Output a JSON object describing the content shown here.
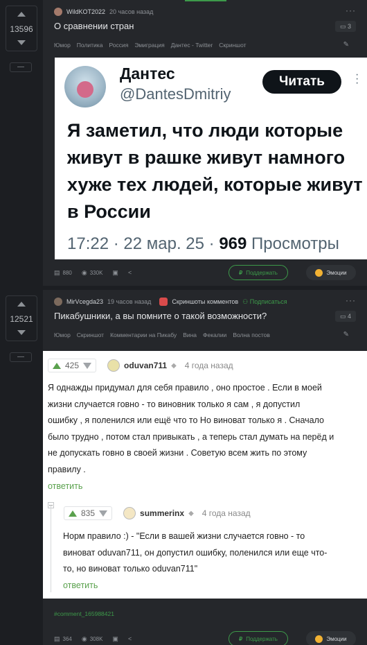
{
  "post1": {
    "votes": "13596",
    "minus": "—",
    "author": "WildKOT2022",
    "time": "20 часов назад",
    "title": "О сравнении стран",
    "comment_count": "3",
    "tags": [
      "Юмор",
      "Политика",
      "Россия",
      "Эмиграция",
      "Дантес - Twitter",
      "Скриншот"
    ],
    "tweet": {
      "name": "Дантес",
      "handle": "@DantesDmitriy",
      "follow_label": "Читать",
      "text": "Я заметил, что люди которые живут в рашке живут намного хуже  тех людей, которые живут в России",
      "footer_time": "17:22 · 22 мар. 25 · ",
      "views_num": "969",
      "views_label": " Просмотры"
    },
    "actions": {
      "comments": "880",
      "views": "330K",
      "support_label": "Поддержать",
      "emotions_label": "Эмоции"
    }
  },
  "post2": {
    "votes": "12521",
    "minus": "—",
    "author": "MirVcegda23",
    "time": "19 часов назад",
    "community": "Скриншоты комментов",
    "subscribe": "Подписаться",
    "title": "Пикабушники, а вы помните о такой возможности?",
    "comment_count": "4",
    "tags": [
      "Юмор",
      "Скриншот",
      "Комментарии на Пикабу",
      "Вина",
      "Фекалии",
      "Волна постов"
    ],
    "comment1": {
      "rating": "425",
      "user": "oduvan711",
      "time": "4 года назад",
      "lines": [
        "Я однажды придумал для себя правило , оно простое . Если в моей",
        "жизни случается говно - то виновник только я сам , я допустил",
        "ошибку , я поленился или ещё что то Но виноват только я . Сначало",
        "было трудно , потом стал привыкать , а теперь стал думать на перёд и",
        "не допускать говно в своей жизни . Советую всем жить по этому",
        "правилу ."
      ],
      "reply": "ответить"
    },
    "comment2": {
      "rating": "835",
      "user": "summerinx",
      "time": "4 года назад",
      "lines": [
        "Норм правило :)  - \"Если в вашей жизни случается говно - то",
        "виноват oduvan711, он допустил ошибку, поленился или еще что-",
        "то, но виноват только oduvan711\""
      ],
      "reply": "ответить"
    },
    "comment_link": "#comment_165988421",
    "actions": {
      "comments": "364",
      "views": "308K",
      "support_label": "Поддержать",
      "emotions_label": "Эмоции"
    }
  }
}
